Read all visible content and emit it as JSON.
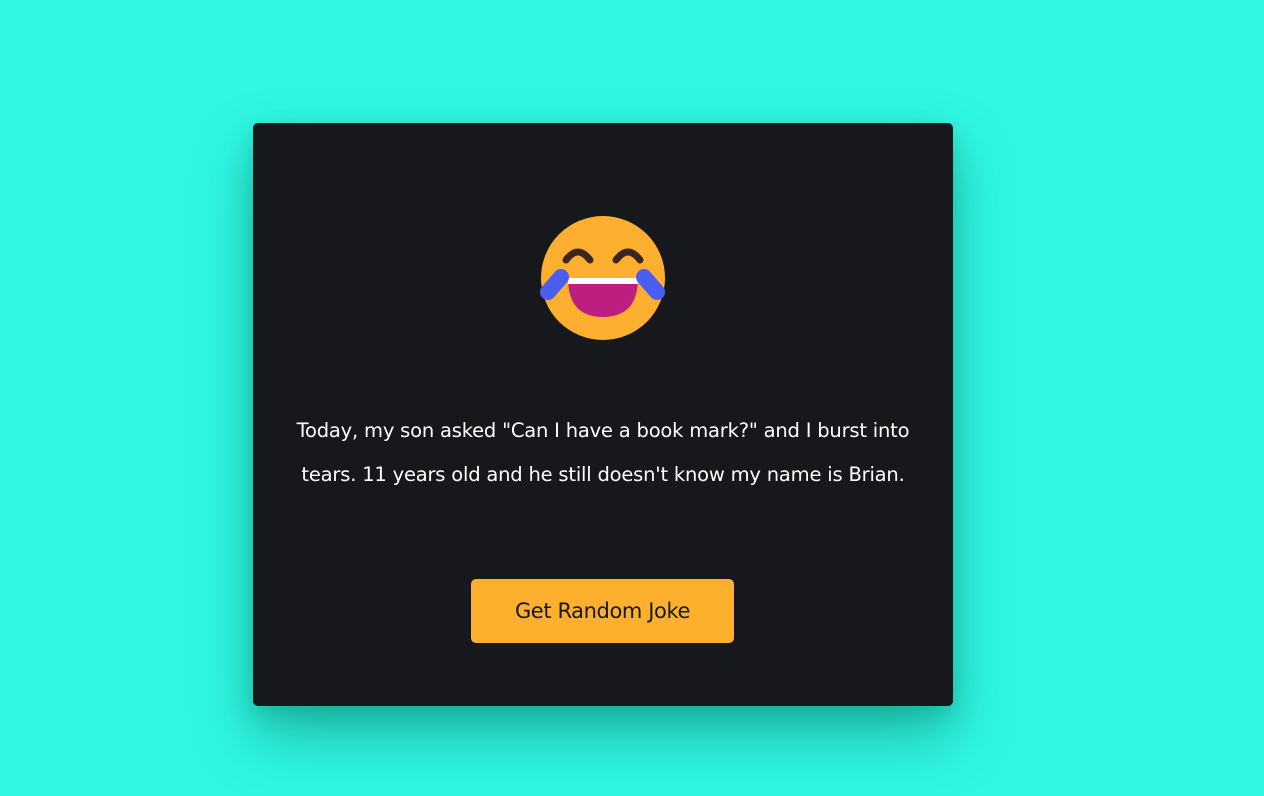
{
  "page": {
    "background_color": "#2ff7e3"
  },
  "card": {
    "background_color": "#17181c",
    "emoji": {
      "icon": "face-with-tears-of-joy-icon"
    },
    "joke_text": "Today, my son asked \"Can I have a book mark?\" and I burst into tears. 11 years old and he still doesn't know my name is Brian.",
    "button": {
      "label": "Get Random Joke",
      "color": "#fdaf2e"
    }
  }
}
